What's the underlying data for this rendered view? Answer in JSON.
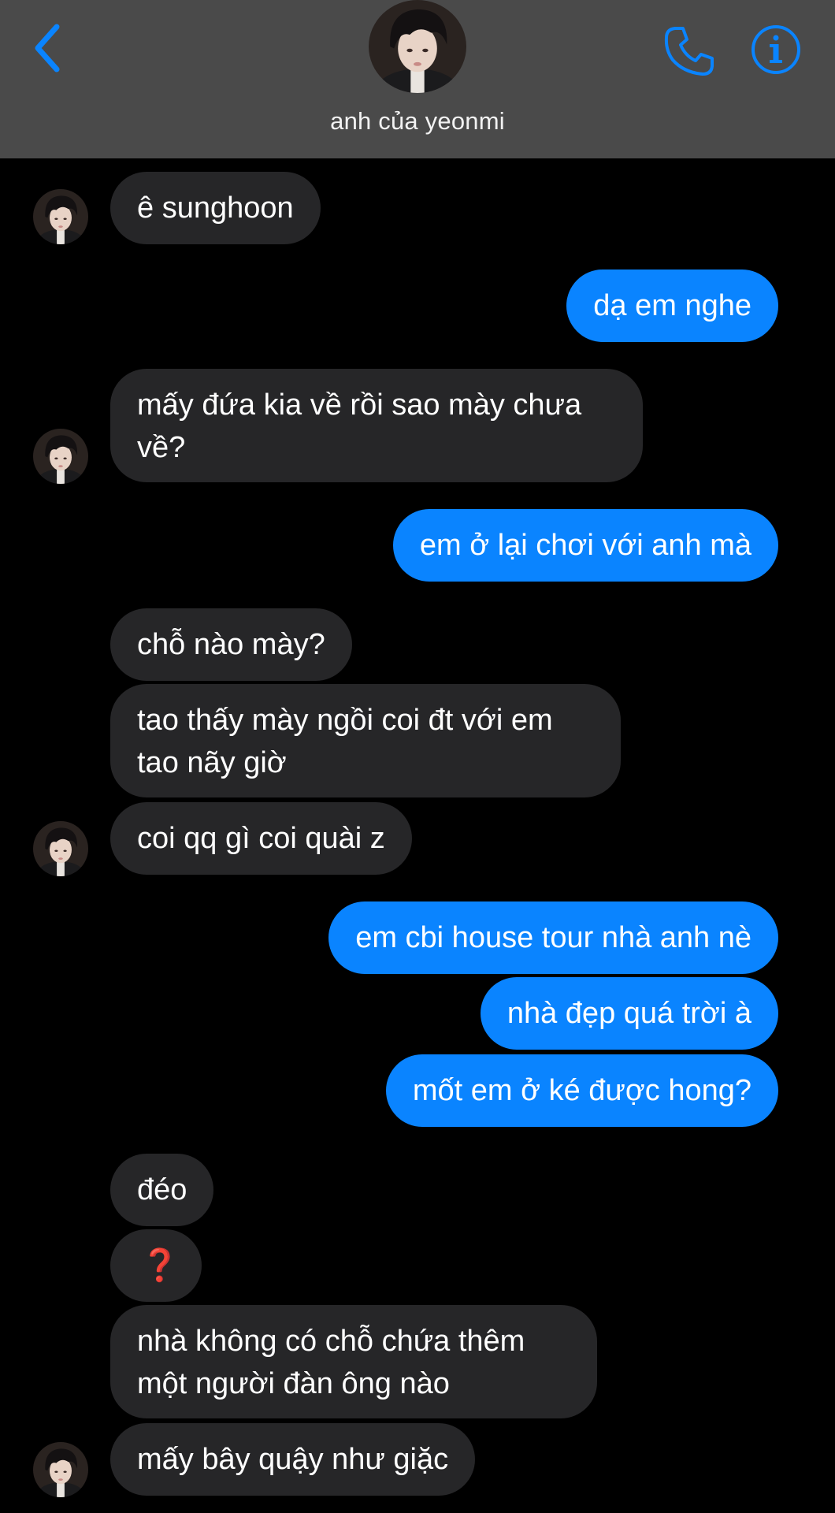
{
  "header": {
    "contact_name": "anh của yeonmi",
    "back_icon": "chevron-left-icon",
    "call_icon": "phone-icon",
    "info_icon": "info-icon",
    "accent_color": "#0a84ff",
    "background_color": "#4a4a4a"
  },
  "messages": [
    {
      "side": "incoming",
      "text": "ê sunghoon"
    },
    {
      "side": "outgoing",
      "text": "dạ em nghe"
    },
    {
      "side": "incoming",
      "text": "mấy đứa kia về rồi sao mày chưa về?"
    },
    {
      "side": "outgoing",
      "text": "em ở lại chơi với anh mà"
    },
    {
      "side": "incoming",
      "text": "chỗ nào mày?"
    },
    {
      "side": "incoming",
      "text": "tao thấy mày ngồi coi đt với em tao nãy giờ"
    },
    {
      "side": "incoming",
      "text": "coi qq gì coi quài z"
    },
    {
      "side": "outgoing",
      "text": "em cbi house tour nhà anh nè"
    },
    {
      "side": "outgoing",
      "text": "nhà đẹp quá trời à"
    },
    {
      "side": "outgoing",
      "text": "mốt em ở ké được hong?"
    },
    {
      "side": "incoming",
      "text": "đéo"
    },
    {
      "side": "incoming",
      "text": "❓"
    },
    {
      "side": "incoming",
      "text": "nhà không có chỗ chứa thêm một người đàn ông nào"
    },
    {
      "side": "incoming",
      "text": "mấy bây quậy như giặc"
    }
  ],
  "colors": {
    "incoming_bubble": "#262628",
    "outgoing_bubble": "#0a84ff",
    "screen_background": "#000000"
  }
}
